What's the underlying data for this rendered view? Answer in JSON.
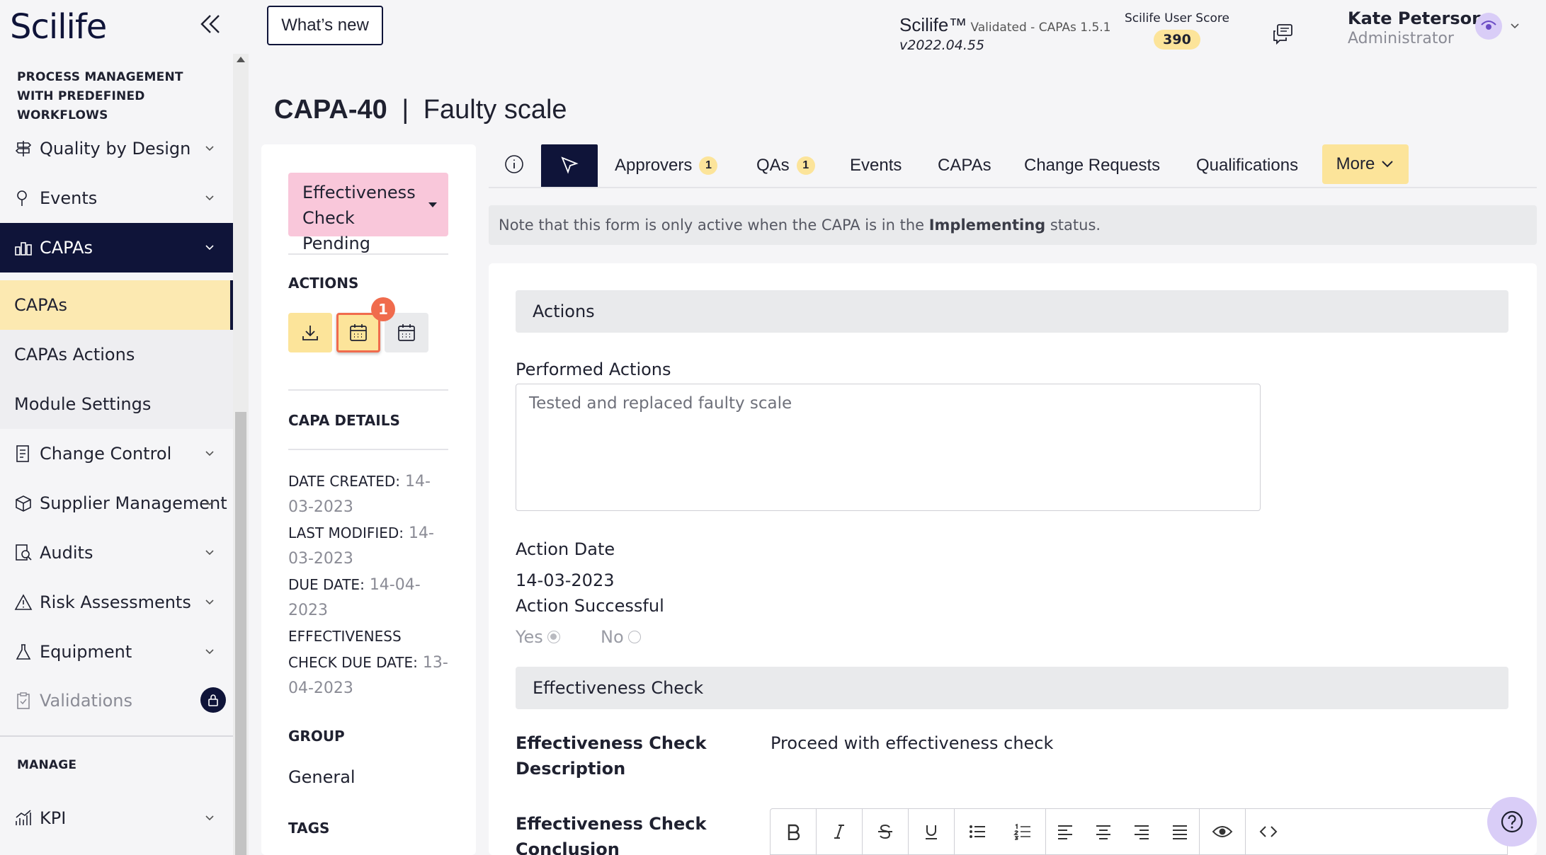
{
  "brand": {
    "logo": "Scilife"
  },
  "sidebar": {
    "section_process": "PROCESS MANAGEMENT WITH PREDEFINED WORKFLOWS",
    "items": [
      {
        "label": "Quality by Design",
        "icon": "signpost-icon"
      },
      {
        "label": "Events",
        "icon": "location-pin-icon"
      },
      {
        "label": "CAPAs",
        "icon": "capa-icon"
      }
    ],
    "sub_items": [
      {
        "label": "CAPAs"
      },
      {
        "label": "CAPAs Actions"
      },
      {
        "label": "Module Settings"
      }
    ],
    "more_items": [
      {
        "label": "Change Control",
        "icon": "document-icon"
      },
      {
        "label": "Supplier Management",
        "icon": "box-icon"
      },
      {
        "label": "Audits",
        "icon": "audit-icon"
      },
      {
        "label": "Risk Assessments",
        "icon": "warning-icon"
      },
      {
        "label": "Equipment",
        "icon": "flask-icon"
      },
      {
        "label": "Validations",
        "icon": "clipboard-icon"
      }
    ],
    "section_manage": "MANAGE",
    "kpi": {
      "label": "KPI",
      "icon": "chart-icon"
    }
  },
  "header": {
    "whats_new": "What’s new",
    "app_name": "Scilife™",
    "app_validated": "Validated - CAPAs 1.5.1",
    "app_version": "v2022.04.55",
    "score_label": "Scilife User Score",
    "score_value": "390",
    "user_name": "Kate Peterson",
    "user_role": "Administrator"
  },
  "page": {
    "id": "CAPA-40",
    "separator": "|",
    "title": "Faulty scale"
  },
  "left_panel": {
    "status_line1": "Effectiveness",
    "status_line2": "Check Pending",
    "actions_heading": "ACTIONS",
    "badge": "1",
    "details_heading": "CAPA DETAILS",
    "details": [
      {
        "key": "DATE CREATED:",
        "value": "14-03-2023"
      },
      {
        "key": "LAST MODIFIED:",
        "value": "14-03-2023"
      },
      {
        "key": "DUE DATE:",
        "value": "14-04-2023"
      },
      {
        "key": "EFFECTIVENESS CHECK DUE DATE:",
        "value": "13-04-2023"
      }
    ],
    "group_heading": "GROUP",
    "group_value": "General",
    "tags_heading": "TAGS"
  },
  "tabs": {
    "approvers": "Approvers",
    "approvers_count": "1",
    "qas": "QAs",
    "qas_count": "1",
    "events": "Events",
    "capas": "CAPAs",
    "change_requests": "Change Requests",
    "qualifications": "Qualifications",
    "more": "More"
  },
  "note": {
    "before": "Note that this form is only active when the CAPA is in the ",
    "status": "Implementing",
    "after": " status."
  },
  "form": {
    "actions_section": "Actions",
    "performed_label": "Performed Actions",
    "performed_value": "Tested and replaced faulty scale",
    "action_date_label": "Action Date",
    "action_date_value": "14-03-2023",
    "action_successful_label": "Action Successful",
    "yes": "Yes",
    "no": "No",
    "effectiveness_section": "Effectiveness Check",
    "desc_label": "Effectiveness Check Description",
    "desc_value": "Proceed with effectiveness check",
    "conclusion_label": "Effectiveness Check Conclusion"
  },
  "colors": {
    "navy": "#0f1439",
    "yellow": "#fce49a",
    "pink": "#f9c7da",
    "badge": "#f06b4d",
    "lavender": "#d9cdf7"
  }
}
